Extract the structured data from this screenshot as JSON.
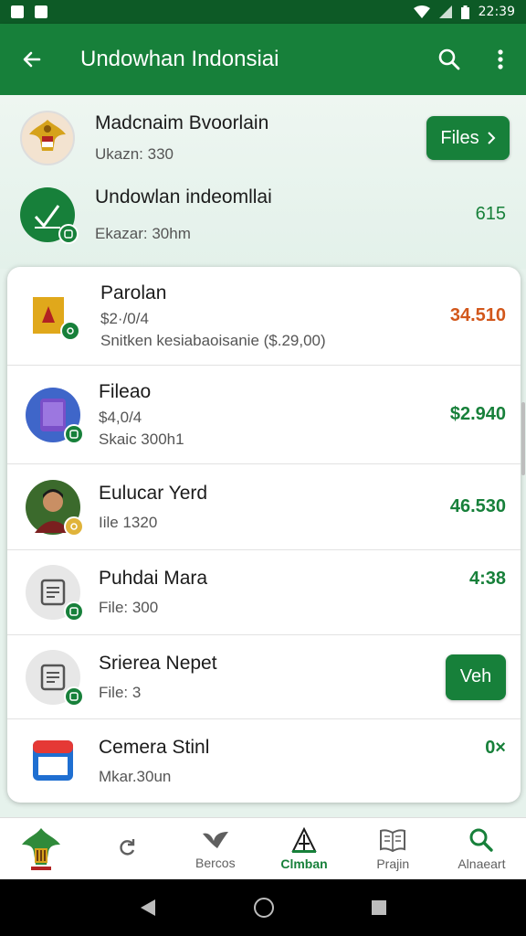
{
  "status_bar": {
    "time": "22:39"
  },
  "app_bar": {
    "title": "Undowhan Indonsiai"
  },
  "top_items": [
    {
      "name": "Madcnaim Bvoorlain",
      "sub": "Ukazn: 330",
      "button": "Files"
    },
    {
      "name": "Undowlan indeomllai",
      "sub": "Ekazar: 30hm",
      "value": "615"
    }
  ],
  "card_items": [
    {
      "name": "Parolan",
      "sub1": "$2·/0/4",
      "sub2": "Snitken kesiabaoisanie ($.29,00)",
      "value": "34.510",
      "value_color": "#d2571b"
    },
    {
      "name": "Fileao",
      "sub1": "$4,0/4",
      "sub2": "Skaic 300h1",
      "value": "$2.940",
      "value_color": "#17803a"
    },
    {
      "name": "Eulucar Yerd",
      "sub1": "Iile 1320",
      "value": "46.530",
      "value_color": "#17803a"
    },
    {
      "name": "Puhdai Mara",
      "sub1": "File: 300",
      "value": "4:38",
      "value_color": "#17803a"
    },
    {
      "name": "Srierea Nepet",
      "sub1": "File: 3",
      "button": "Veh"
    },
    {
      "name": "Cemera Stinl",
      "sub1": "Mkar.30un",
      "value": "0×",
      "value_color": "#17803a"
    }
  ],
  "bottom_nav": [
    {
      "label": "",
      "icon": "refresh-icon"
    },
    {
      "label": "Bercos",
      "icon": "bird-icon"
    },
    {
      "label": "Clmban",
      "icon": "monument-icon",
      "active": true
    },
    {
      "label": "Prajin",
      "icon": "book-icon"
    },
    {
      "label": "Alnaeart",
      "icon": "search-icon"
    }
  ],
  "colors": {
    "primary": "#17803a",
    "status_bar": "#0d5a26",
    "accent_orange": "#d2571b"
  }
}
